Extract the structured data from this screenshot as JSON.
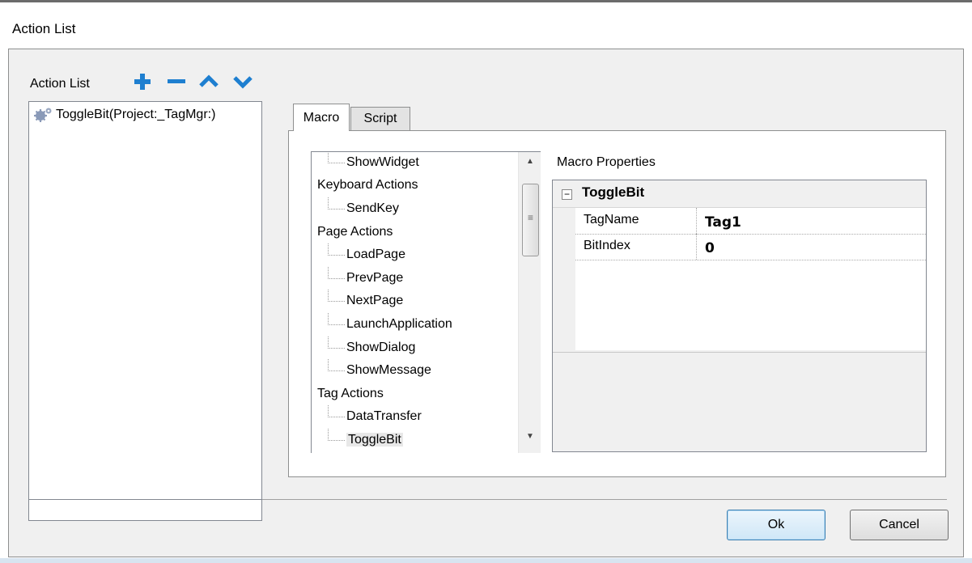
{
  "window": {
    "title": "Action List"
  },
  "left": {
    "label": "Action List",
    "toolbar": {
      "add_icon": "plus-icon",
      "remove_icon": "minus-icon",
      "up_icon": "chevron-up-icon",
      "down_icon": "chevron-down-icon",
      "icon_color": "#1e7fd0"
    },
    "items": [
      {
        "label": "ToggleBit(Project:_TagMgr:)",
        "icon": "gears-icon"
      }
    ]
  },
  "tabs": [
    {
      "label": "Macro",
      "selected": true
    },
    {
      "label": "Script",
      "selected": false
    }
  ],
  "tree": {
    "rows": [
      {
        "label": "ShowWidget",
        "kind": "leaf"
      },
      {
        "label": "Keyboard Actions",
        "kind": "category"
      },
      {
        "label": "SendKey",
        "kind": "leaf"
      },
      {
        "label": "Page Actions",
        "kind": "category"
      },
      {
        "label": "LoadPage",
        "kind": "leaf"
      },
      {
        "label": "PrevPage",
        "kind": "leaf"
      },
      {
        "label": "NextPage",
        "kind": "leaf"
      },
      {
        "label": "LaunchApplication",
        "kind": "leaf"
      },
      {
        "label": "ShowDialog",
        "kind": "leaf"
      },
      {
        "label": "ShowMessage",
        "kind": "leaf"
      },
      {
        "label": "Tag Actions",
        "kind": "category"
      },
      {
        "label": "DataTransfer",
        "kind": "leaf"
      },
      {
        "label": "ToggleBit",
        "kind": "leaf",
        "selected": true
      }
    ],
    "scroll_up_glyph": "▲",
    "scroll_down_glyph": "▼",
    "scroll_grip_glyph": "≡"
  },
  "properties": {
    "label": "Macro Properties",
    "collapse_glyph": "−",
    "group": "ToggleBit",
    "rows": [
      {
        "name": "TagName",
        "value": "Tag1"
      },
      {
        "name": "BitIndex",
        "value": "0"
      }
    ]
  },
  "buttons": {
    "ok": "Ok",
    "cancel": "Cancel"
  }
}
